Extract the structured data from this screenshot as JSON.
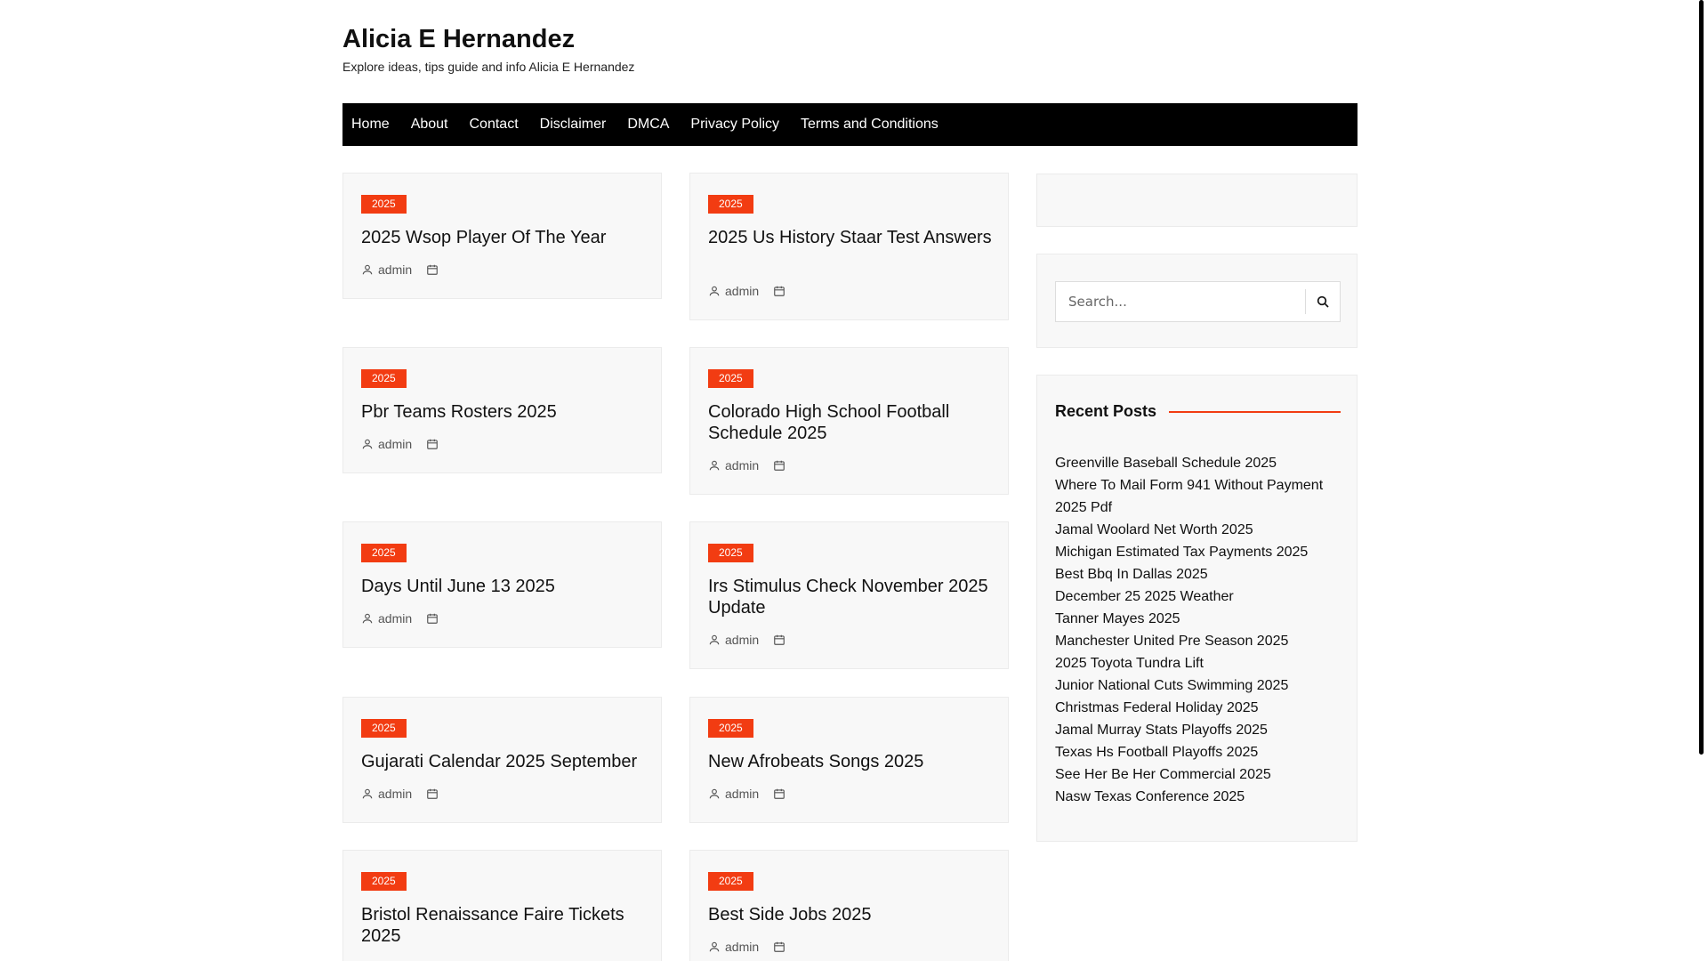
{
  "site": {
    "title": "Alicia E Hernandez",
    "tagline": "Explore ideas, tips guide and info Alicia E Hernandez"
  },
  "nav": {
    "items": [
      "Home",
      "About",
      "Contact",
      "Disclaimer",
      "DMCA",
      "Privacy Policy",
      "Terms and Conditions"
    ]
  },
  "posts": [
    {
      "category": "2025",
      "title": "2025 Wsop Player Of The Year",
      "author": "admin"
    },
    {
      "category": "2025",
      "title": "2025 Us History Staar Test Answers",
      "author": "admin"
    },
    {
      "category": "2025",
      "title": "Pbr Teams Rosters 2025",
      "author": "admin"
    },
    {
      "category": "2025",
      "title": "Colorado High School Football Schedule 2025",
      "author": "admin"
    },
    {
      "category": "2025",
      "title": "Days Until June 13 2025",
      "author": "admin"
    },
    {
      "category": "2025",
      "title": "Irs Stimulus Check November 2025 Update",
      "author": "admin"
    },
    {
      "category": "2025",
      "title": "Gujarati Calendar 2025 September",
      "author": "admin"
    },
    {
      "category": "2025",
      "title": "New Afrobeats Songs 2025",
      "author": "admin"
    },
    {
      "category": "2025",
      "title": "Bristol Renaissance Faire Tickets 2025",
      "author": "admin"
    },
    {
      "category": "2025",
      "title": "Best Side Jobs 2025",
      "author": "admin"
    }
  ],
  "search": {
    "placeholder": "Search..."
  },
  "recent": {
    "heading": "Recent Posts",
    "items": [
      "Greenville Baseball Schedule 2025",
      "Where To Mail Form 941 Without Payment 2025 Pdf",
      "Jamal Woolard Net Worth 2025",
      "Michigan Estimated Tax Payments 2025",
      "Best Bbq In Dallas 2025",
      "December 25 2025 Weather",
      "Tanner Mayes 2025",
      "Manchester United Pre Season 2025",
      "2025 Toyota Tundra Lift",
      "Junior National Cuts Swimming 2025",
      "Christmas Federal Holiday 2025",
      "Jamal Murray Stats Playoffs 2025",
      "Texas Hs Football Playoffs 2025",
      "See Her Be Her Commercial 2025",
      "Nasw Texas Conference 2025"
    ]
  }
}
